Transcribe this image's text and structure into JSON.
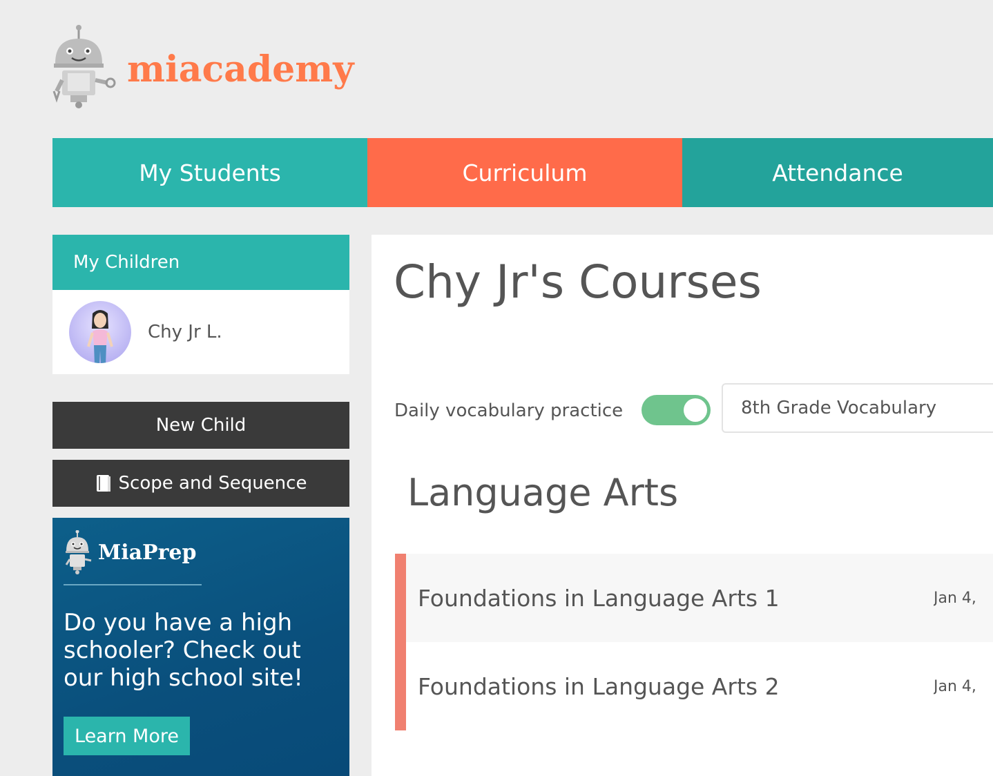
{
  "brand": {
    "name": "miacademy",
    "color": "#ff7a4a"
  },
  "nav": {
    "tabs": [
      {
        "label": "My Students",
        "color": "#2bb5ac"
      },
      {
        "label": "Curriculum",
        "color": "#ff6b4a",
        "active": true
      },
      {
        "label": "Attendance",
        "color": "#23a39b"
      }
    ]
  },
  "sidebar": {
    "children_header": "My Children",
    "children": [
      {
        "name": "Chy Jr L."
      }
    ],
    "new_child_label": "New Child",
    "scope_label": "Scope and Sequence",
    "promo": {
      "brand": "MiaPrep",
      "text": "Do you have a high schooler? Check out our high school site!",
      "button_label": "Learn More"
    }
  },
  "main": {
    "title": "Chy Jr's Courses",
    "vocab": {
      "label": "Daily vocabulary practice",
      "enabled": true,
      "selected": "8th Grade Vocabulary"
    },
    "sections": [
      {
        "title": "Language Arts",
        "accent": "#f08070",
        "courses": [
          {
            "name": "Foundations in Language Arts 1",
            "date": "Jan 4,"
          },
          {
            "name": "Foundations in Language Arts 2",
            "date": "Jan 4,"
          }
        ]
      }
    ]
  }
}
